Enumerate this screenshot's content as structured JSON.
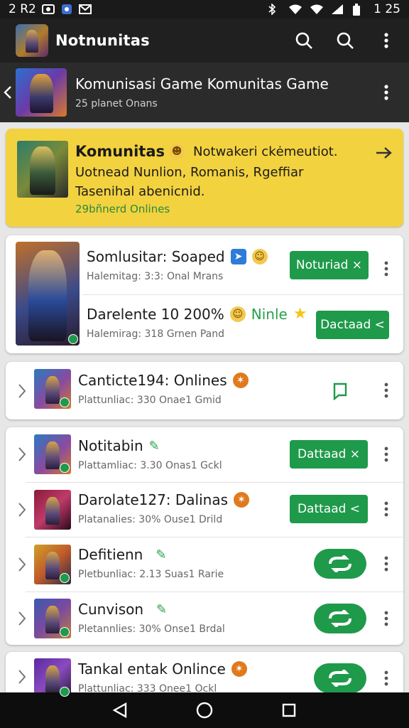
{
  "status_bar": {
    "time_left": "2 R2 ",
    "time_right": "1 25"
  },
  "app_bar": {
    "title": "Notnunitas"
  },
  "group_header": {
    "title": "Komunisasi Game Komunitas Game",
    "subtitle": "25 planet Onans"
  },
  "highlight": {
    "title": "Komunitas",
    "title_extra": "Notwakeri ckėmeutiot.",
    "description": "Uotnead Nunlion, Romanis, Rgeffiar Tasenihal abenicnid.",
    "count": "29bñnerd Onlines"
  },
  "featured_card": {
    "rows": [
      {
        "title": "Somlusitar: Soaped",
        "subtitle": "Halemitag: 3:3: Onal Mrans",
        "button": "Noturiad ×"
      },
      {
        "title": "Darelente 10 200%",
        "title_extra": "Ninle",
        "subtitle": "Halemirag: 318 Grnen Pand",
        "button": "Dactaad <"
      }
    ]
  },
  "single_card": {
    "title": "Canticte194: Onlines",
    "subtitle": "Plattunliac: 330 Onae1 Gmid"
  },
  "list_card": {
    "rows": [
      {
        "title": "Notitabin",
        "subtitle": "Plattamliac: 3.30 Onas1 Gckl",
        "button": "Dattaad ×"
      },
      {
        "title": "Darolate127: Dalinas",
        "subtitle": "Platanalies: 30% Ouse1 Drild",
        "button": "Dattaad <"
      },
      {
        "title": "Defitienn",
        "subtitle": "Pletbunliac: 2.13 Suas1 Rarie"
      },
      {
        "title": "Cunvison",
        "subtitle": "Pletannlies: 30% Onse1 Brdal"
      }
    ]
  },
  "bottom_card": {
    "title": "Tankal entak Onlince",
    "subtitle": "Plattunliac: 333 Onee1 Ockl"
  },
  "colors": {
    "accent_green": "#1e9a4a",
    "highlight_yellow": "#f3d23f",
    "bar_dark": "#202020"
  }
}
